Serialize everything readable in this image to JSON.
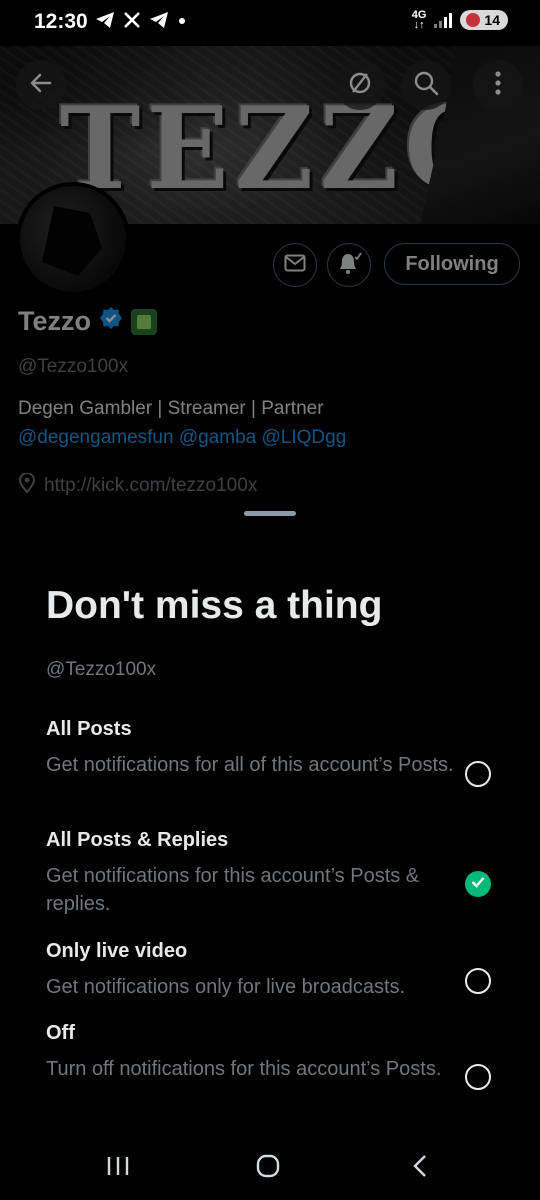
{
  "status_bar": {
    "time": "12:30",
    "network": "4G",
    "battery": "14",
    "notification_icons": [
      "telegram-icon",
      "x-icon",
      "telegram-icon",
      "dot-icon"
    ]
  },
  "header": {
    "banner_text": "TEZZO",
    "buttons": [
      "back-icon",
      "cancel-icon",
      "search-icon",
      "more-icon"
    ]
  },
  "profile": {
    "name": "Tezzo",
    "handle": "@Tezzo100x",
    "bio_line1": "Degen Gambler | Streamer | Partner",
    "bio_line2": "@degengamesfun @gamba @LIQDgg",
    "link": "http://kick.com/tezzo100x",
    "following_label": "Following"
  },
  "sheet": {
    "title": "Don't miss a thing",
    "handle": "@Tezzo100x",
    "options": [
      {
        "title": "All Posts",
        "desc": "Get notifications for all of this account’s Posts.",
        "selected": false
      },
      {
        "title": "All Posts & Replies",
        "desc": "Get notifications for this account’s Posts & replies.",
        "selected": true
      },
      {
        "title": "Only live video",
        "desc": "Get notifications only for live broadcasts.",
        "selected": false
      },
      {
        "title": "Off",
        "desc": "Turn off notifications for this account’s Posts.",
        "selected": false
      }
    ]
  },
  "colors": {
    "accent_blue": "#1d9bf0",
    "selected_green": "#00ba7c",
    "muted_text": "#71767b"
  },
  "navbar": [
    "recents-icon",
    "home-icon",
    "back-icon"
  ]
}
